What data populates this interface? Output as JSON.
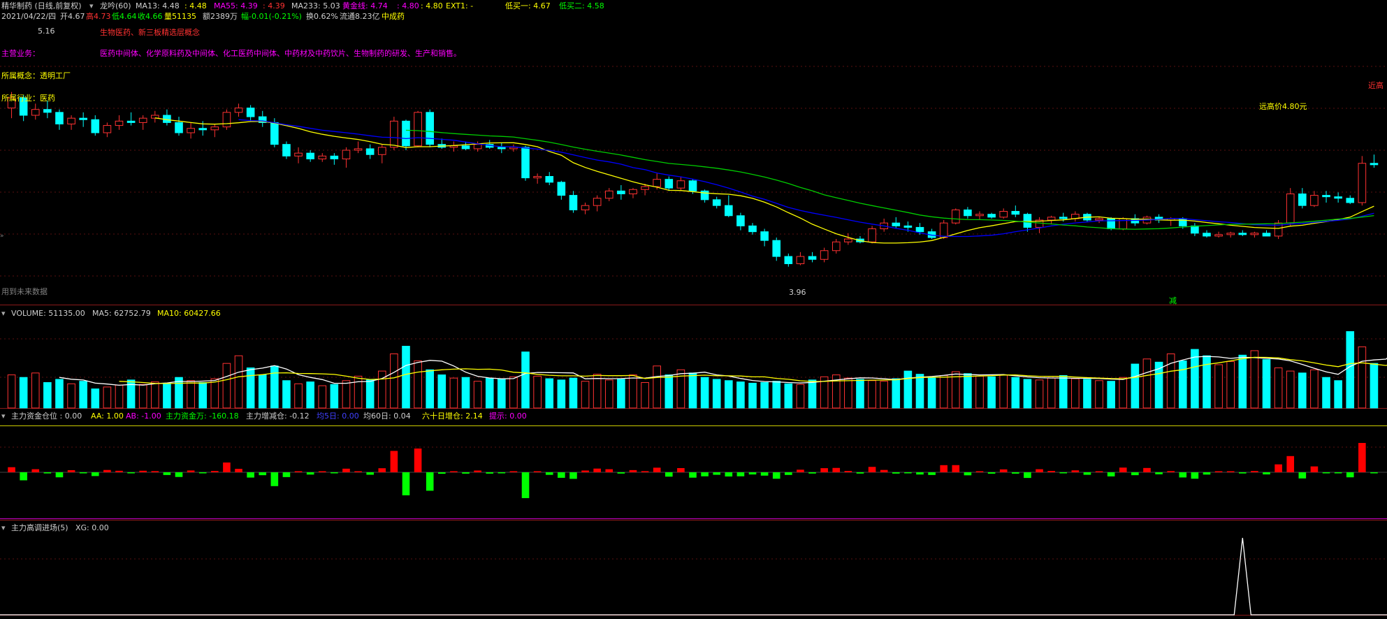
{
  "header": {
    "title": "精华制药 (日线,前复权)",
    "indicator": "龙吟(60)",
    "ma13": "MA13: 4.48",
    "ma13_b": ": 4.48",
    "ma55": "MA55: 4.39",
    "ma55_b": ": 4.39",
    "ma233": "MA233: 5.03",
    "gold": "黄金线: 4.74",
    "gold_b": ": 4.80",
    "gold_c": ": 4.80",
    "ext1": "EXT1: -",
    "low_buy1": "低买一: 4.67",
    "low_buy2": "低买二: 4.58"
  },
  "info_bar": {
    "date": "2021/04/22/四",
    "open": "开4.67",
    "high": "高4.73",
    "low": "低4.64",
    "close": "收4.66",
    "volume": "量51135",
    "amount": "额2389万",
    "change": "幅-0.01(-0.21%)",
    "turnover": "换0.62%",
    "float": "流通8.23亿",
    "sector": "中成药"
  },
  "overlay": {
    "tag_text": "生物医药、新三板精选层概念",
    "business_label": "主营业务：",
    "business_text": "医药中间体、化学原料药及中间体、化工医药中间体、中药材及中药饮片、生物制药的研发、生产和销售。",
    "concept": "所属概念：透明工厂",
    "industry": "所属行业：医药",
    "far_high": "远高价4.80元",
    "near_high": "近高",
    "high_marker": "5.16",
    "low_marker": "3.96",
    "future_data": "用到未来数据",
    "cut_label": "减"
  },
  "volume_panel": {
    "vol": "VOLUME: 51135.00",
    "ma5": "MA5: 62752.79",
    "ma10": "MA10: 60427.66"
  },
  "fund_panel": {
    "pos": "主力资金仓位 : 0.00",
    "aa": "AA: 1.00",
    "ab": "AB: -1.00",
    "flow": "主力资金万: -160.18",
    "inc": "主力增减仓: -0.12",
    "ma5": "均5日: 0.00",
    "ma60": "均60日: 0.04",
    "sixty": "六十日增仓: 2.14",
    "hint": "提示: 0.00"
  },
  "entry_panel": {
    "title": "主力高调进场(5)",
    "xg": "XG: 0.00"
  },
  "colors": {
    "up": "#ff3232",
    "down": "#00ffff",
    "ma13": "#ffff00",
    "ma55": "#0000ff",
    "ma233": "#00cc00",
    "white_line": "#ffffff",
    "magenta": "#ff00ff"
  },
  "chart_data": {
    "type": "candlestick",
    "price": {
      "ylim": [
        3.8,
        5.6
      ],
      "candles": [
        {
          "o": 5.05,
          "h": 5.16,
          "l": 4.98,
          "c": 5.12
        },
        {
          "o": 5.12,
          "h": 5.14,
          "l": 4.96,
          "c": 5.0
        },
        {
          "o": 5.0,
          "h": 5.08,
          "l": 4.97,
          "c": 5.04
        },
        {
          "o": 5.04,
          "h": 5.1,
          "l": 4.98,
          "c": 5.02
        },
        {
          "o": 5.02,
          "h": 5.04,
          "l": 4.9,
          "c": 4.94
        },
        {
          "o": 4.94,
          "h": 5.0,
          "l": 4.9,
          "c": 4.98
        },
        {
          "o": 4.98,
          "h": 5.02,
          "l": 4.92,
          "c": 4.97
        },
        {
          "o": 4.97,
          "h": 5.0,
          "l": 4.86,
          "c": 4.88
        },
        {
          "o": 4.88,
          "h": 4.95,
          "l": 4.85,
          "c": 4.93
        },
        {
          "o": 4.93,
          "h": 5.0,
          "l": 4.9,
          "c": 4.96
        },
        {
          "o": 4.96,
          "h": 5.02,
          "l": 4.93,
          "c": 4.95
        },
        {
          "o": 4.95,
          "h": 5.0,
          "l": 4.9,
          "c": 4.98
        },
        {
          "o": 4.98,
          "h": 5.03,
          "l": 4.95,
          "c": 5.0
        },
        {
          "o": 5.0,
          "h": 5.04,
          "l": 4.93,
          "c": 4.95
        },
        {
          "o": 4.95,
          "h": 4.99,
          "l": 4.86,
          "c": 4.88
        },
        {
          "o": 4.88,
          "h": 4.95,
          "l": 4.84,
          "c": 4.91
        },
        {
          "o": 4.91,
          "h": 4.96,
          "l": 4.86,
          "c": 4.9
        },
        {
          "o": 4.9,
          "h": 4.94,
          "l": 4.85,
          "c": 4.92
        },
        {
          "o": 4.92,
          "h": 5.04,
          "l": 4.9,
          "c": 5.02
        },
        {
          "o": 5.02,
          "h": 5.08,
          "l": 4.99,
          "c": 5.05
        },
        {
          "o": 5.05,
          "h": 5.07,
          "l": 4.96,
          "c": 4.99
        },
        {
          "o": 4.99,
          "h": 5.03,
          "l": 4.92,
          "c": 4.95
        },
        {
          "o": 4.95,
          "h": 4.98,
          "l": 4.78,
          "c": 4.8
        },
        {
          "o": 4.8,
          "h": 4.82,
          "l": 4.7,
          "c": 4.72
        },
        {
          "o": 4.72,
          "h": 4.78,
          "l": 4.67,
          "c": 4.74
        },
        {
          "o": 4.74,
          "h": 4.76,
          "l": 4.68,
          "c": 4.7
        },
        {
          "o": 4.7,
          "h": 4.74,
          "l": 4.68,
          "c": 4.72
        },
        {
          "o": 4.72,
          "h": 4.74,
          "l": 4.66,
          "c": 4.7
        },
        {
          "o": 4.7,
          "h": 4.78,
          "l": 4.64,
          "c": 4.76
        },
        {
          "o": 4.76,
          "h": 4.82,
          "l": 4.74,
          "c": 4.77
        },
        {
          "o": 4.77,
          "h": 4.8,
          "l": 4.7,
          "c": 4.73
        },
        {
          "o": 4.73,
          "h": 4.8,
          "l": 4.67,
          "c": 4.78
        },
        {
          "o": 4.78,
          "h": 4.99,
          "l": 4.76,
          "c": 4.96
        },
        {
          "o": 4.96,
          "h": 4.97,
          "l": 4.76,
          "c": 4.79
        },
        {
          "o": 4.79,
          "h": 5.03,
          "l": 4.78,
          "c": 5.02
        },
        {
          "o": 5.02,
          "h": 5.04,
          "l": 4.78,
          "c": 4.8
        },
        {
          "o": 4.8,
          "h": 4.84,
          "l": 4.77,
          "c": 4.78
        },
        {
          "o": 4.78,
          "h": 4.82,
          "l": 4.75,
          "c": 4.79
        },
        {
          "o": 4.79,
          "h": 4.82,
          "l": 4.76,
          "c": 4.77
        },
        {
          "o": 4.77,
          "h": 4.82,
          "l": 4.75,
          "c": 4.8
        },
        {
          "o": 4.8,
          "h": 4.83,
          "l": 4.77,
          "c": 4.78
        },
        {
          "o": 4.78,
          "h": 4.81,
          "l": 4.74,
          "c": 4.77
        },
        {
          "o": 4.77,
          "h": 4.8,
          "l": 4.75,
          "c": 4.78
        },
        {
          "o": 4.78,
          "h": 4.79,
          "l": 4.55,
          "c": 4.57
        },
        {
          "o": 4.57,
          "h": 4.6,
          "l": 4.53,
          "c": 4.58
        },
        {
          "o": 4.58,
          "h": 4.61,
          "l": 4.52,
          "c": 4.54
        },
        {
          "o": 4.54,
          "h": 4.55,
          "l": 4.42,
          "c": 4.45
        },
        {
          "o": 4.45,
          "h": 4.48,
          "l": 4.33,
          "c": 4.35
        },
        {
          "o": 4.35,
          "h": 4.4,
          "l": 4.32,
          "c": 4.38
        },
        {
          "o": 4.38,
          "h": 4.45,
          "l": 4.34,
          "c": 4.43
        },
        {
          "o": 4.43,
          "h": 4.5,
          "l": 4.41,
          "c": 4.48
        },
        {
          "o": 4.48,
          "h": 4.52,
          "l": 4.42,
          "c": 4.46
        },
        {
          "o": 4.46,
          "h": 4.5,
          "l": 4.43,
          "c": 4.49
        },
        {
          "o": 4.49,
          "h": 4.53,
          "l": 4.45,
          "c": 4.51
        },
        {
          "o": 4.51,
          "h": 4.6,
          "l": 4.49,
          "c": 4.56
        },
        {
          "o": 4.56,
          "h": 4.58,
          "l": 4.48,
          "c": 4.5
        },
        {
          "o": 4.5,
          "h": 4.58,
          "l": 4.48,
          "c": 4.55
        },
        {
          "o": 4.55,
          "h": 4.56,
          "l": 4.46,
          "c": 4.48
        },
        {
          "o": 4.48,
          "h": 4.49,
          "l": 4.4,
          "c": 4.42
        },
        {
          "o": 4.42,
          "h": 4.44,
          "l": 4.36,
          "c": 4.38
        },
        {
          "o": 4.38,
          "h": 4.45,
          "l": 4.3,
          "c": 4.31
        },
        {
          "o": 4.31,
          "h": 4.33,
          "l": 4.21,
          "c": 4.24
        },
        {
          "o": 4.24,
          "h": 4.26,
          "l": 4.18,
          "c": 4.2
        },
        {
          "o": 4.2,
          "h": 4.22,
          "l": 4.1,
          "c": 4.14
        },
        {
          "o": 4.14,
          "h": 4.16,
          "l": 4.0,
          "c": 4.03
        },
        {
          "o": 4.03,
          "h": 4.05,
          "l": 3.96,
          "c": 3.98
        },
        {
          "o": 3.98,
          "h": 4.06,
          "l": 3.97,
          "c": 4.03
        },
        {
          "o": 4.03,
          "h": 4.06,
          "l": 3.99,
          "c": 4.01
        },
        {
          "o": 4.01,
          "h": 4.09,
          "l": 3.99,
          "c": 4.07
        },
        {
          "o": 4.07,
          "h": 4.15,
          "l": 4.05,
          "c": 4.13
        },
        {
          "o": 4.13,
          "h": 4.19,
          "l": 4.11,
          "c": 4.15
        },
        {
          "o": 4.15,
          "h": 4.17,
          "l": 4.12,
          "c": 4.13
        },
        {
          "o": 4.13,
          "h": 4.24,
          "l": 4.12,
          "c": 4.22
        },
        {
          "o": 4.22,
          "h": 4.29,
          "l": 4.2,
          "c": 4.26
        },
        {
          "o": 4.26,
          "h": 4.3,
          "l": 4.22,
          "c": 4.24
        },
        {
          "o": 4.24,
          "h": 4.27,
          "l": 4.2,
          "c": 4.23
        },
        {
          "o": 4.23,
          "h": 4.26,
          "l": 4.18,
          "c": 4.2
        },
        {
          "o": 4.2,
          "h": 4.22,
          "l": 4.15,
          "c": 4.16
        },
        {
          "o": 4.16,
          "h": 4.28,
          "l": 4.15,
          "c": 4.26
        },
        {
          "o": 4.26,
          "h": 4.36,
          "l": 4.25,
          "c": 4.35
        },
        {
          "o": 4.35,
          "h": 4.37,
          "l": 4.29,
          "c": 4.31
        },
        {
          "o": 4.31,
          "h": 4.34,
          "l": 4.28,
          "c": 4.32
        },
        {
          "o": 4.32,
          "h": 4.33,
          "l": 4.29,
          "c": 4.3
        },
        {
          "o": 4.3,
          "h": 4.36,
          "l": 4.29,
          "c": 4.34
        },
        {
          "o": 4.34,
          "h": 4.38,
          "l": 4.3,
          "c": 4.32
        },
        {
          "o": 4.32,
          "h": 4.33,
          "l": 4.2,
          "c": 4.23
        },
        {
          "o": 4.23,
          "h": 4.3,
          "l": 4.19,
          "c": 4.28
        },
        {
          "o": 4.28,
          "h": 4.31,
          "l": 4.25,
          "c": 4.3
        },
        {
          "o": 4.3,
          "h": 4.33,
          "l": 4.27,
          "c": 4.29
        },
        {
          "o": 4.29,
          "h": 4.34,
          "l": 4.27,
          "c": 4.32
        },
        {
          "o": 4.32,
          "h": 4.33,
          "l": 4.27,
          "c": 4.28
        },
        {
          "o": 4.28,
          "h": 4.3,
          "l": 4.26,
          "c": 4.29
        },
        {
          "o": 4.29,
          "h": 4.3,
          "l": 4.21,
          "c": 4.22
        },
        {
          "o": 4.22,
          "h": 4.3,
          "l": 4.21,
          "c": 4.29
        },
        {
          "o": 4.29,
          "h": 4.32,
          "l": 4.24,
          "c": 4.26
        },
        {
          "o": 4.26,
          "h": 4.31,
          "l": 4.25,
          "c": 4.3
        },
        {
          "o": 4.3,
          "h": 4.32,
          "l": 4.26,
          "c": 4.28
        },
        {
          "o": 4.28,
          "h": 4.3,
          "l": 4.24,
          "c": 4.29
        },
        {
          "o": 4.29,
          "h": 4.3,
          "l": 4.22,
          "c": 4.24
        },
        {
          "o": 4.24,
          "h": 4.26,
          "l": 4.17,
          "c": 4.19
        },
        {
          "o": 4.19,
          "h": 4.21,
          "l": 4.16,
          "c": 4.17
        },
        {
          "o": 4.17,
          "h": 4.2,
          "l": 4.16,
          "c": 4.18
        },
        {
          "o": 4.18,
          "h": 4.2,
          "l": 4.16,
          "c": 4.19
        },
        {
          "o": 4.19,
          "h": 4.21,
          "l": 4.17,
          "c": 4.18
        },
        {
          "o": 4.18,
          "h": 4.2,
          "l": 4.16,
          "c": 4.19
        },
        {
          "o": 4.19,
          "h": 4.21,
          "l": 4.17,
          "c": 4.17
        },
        {
          "o": 4.17,
          "h": 4.28,
          "l": 4.15,
          "c": 4.26
        },
        {
          "o": 4.26,
          "h": 4.5,
          "l": 4.24,
          "c": 4.46
        },
        {
          "o": 4.46,
          "h": 4.5,
          "l": 4.36,
          "c": 4.38
        },
        {
          "o": 4.38,
          "h": 4.48,
          "l": 4.37,
          "c": 4.45
        },
        {
          "o": 4.45,
          "h": 4.48,
          "l": 4.4,
          "c": 4.44
        },
        {
          "o": 4.44,
          "h": 4.47,
          "l": 4.4,
          "c": 4.43
        },
        {
          "o": 4.43,
          "h": 4.45,
          "l": 4.39,
          "c": 4.4
        },
        {
          "o": 4.4,
          "h": 4.72,
          "l": 4.38,
          "c": 4.67
        },
        {
          "o": 4.67,
          "h": 4.73,
          "l": 4.64,
          "c": 4.66
        }
      ],
      "ma13": [
        4.32,
        4.31,
        4.31,
        4.32,
        4.33,
        4.34,
        4.36,
        4.38,
        4.4,
        4.42,
        4.44,
        4.46,
        4.48
      ],
      "ma55_tail": [
        4.36,
        4.37,
        4.38,
        4.39
      ],
      "ma233_tail": [
        5.3,
        5.24,
        5.18,
        5.12,
        5.08,
        5.05,
        5.03
      ]
    },
    "volume": {
      "ylim": [
        0,
        125000
      ],
      "values": [
        52000,
        48000,
        55000,
        40000,
        45000,
        38000,
        42000,
        30000,
        33000,
        36000,
        44000,
        37000,
        41000,
        39000,
        48000,
        43000,
        40000,
        46000,
        70000,
        82000,
        63000,
        52000,
        66000,
        43000,
        38000,
        41000,
        35000,
        37000,
        43000,
        50000,
        44000,
        58000,
        85000,
        97000,
        74000,
        60000,
        52000,
        47000,
        48000,
        42000,
        47000,
        45000,
        49000,
        88000,
        50000,
        46000,
        44000,
        47000,
        42000,
        53000,
        44000,
        45000,
        52000,
        40000,
        66000,
        52000,
        60000,
        55000,
        48000,
        45000,
        43000,
        41000,
        39000,
        40000,
        42000,
        38000,
        37000,
        44000,
        49000,
        52000,
        47000,
        45000,
        43000,
        42000,
        46000,
        58000,
        53000,
        48000,
        51000,
        57000,
        54000,
        50000,
        49000,
        52000,
        48000,
        45000,
        44000,
        47000,
        51000,
        46000,
        45000,
        43000,
        42000,
        48000,
        69000,
        77000,
        72000,
        85000,
        74000,
        92000,
        82000,
        68000,
        73000,
        83000,
        90000,
        76000,
        63000,
        58000,
        55000,
        60000,
        48000,
        43000,
        120000,
        96000,
        70000,
        55000,
        125000,
        51135
      ]
    },
    "fund": {
      "ylim": [
        -1,
        1
      ]
    },
    "entry": {
      "ylim": [
        0,
        1
      ]
    }
  }
}
